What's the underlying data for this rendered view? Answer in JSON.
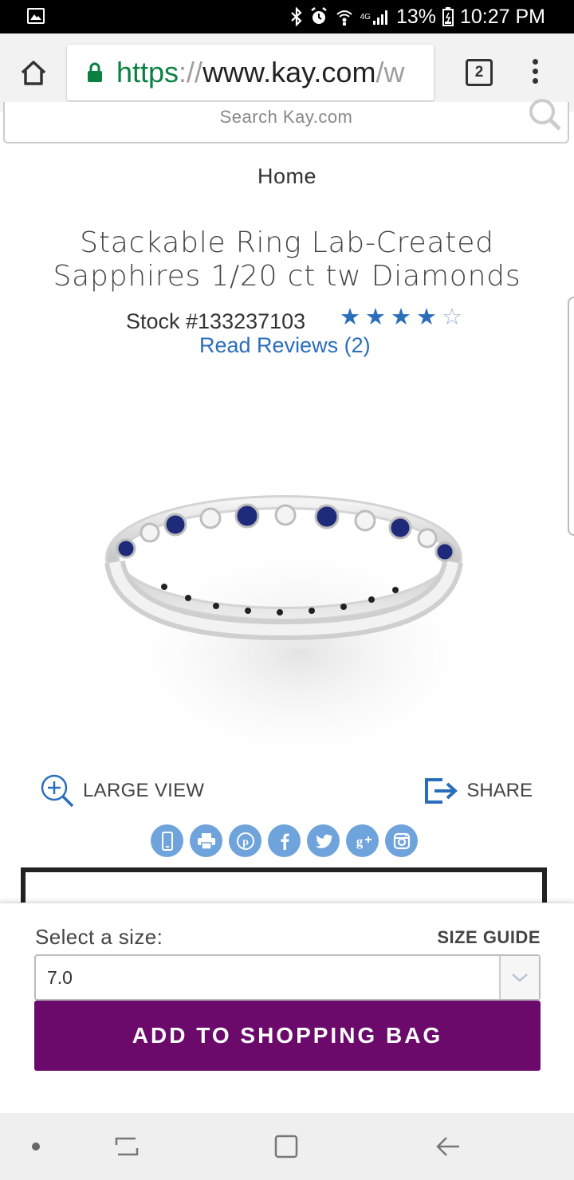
{
  "status_bar": {
    "network": "4G",
    "battery": "13%",
    "time": "10:27 PM"
  },
  "browser": {
    "url_scheme": "https",
    "url_sep": "://",
    "url_host": "www.kay.com",
    "url_rest": "/w",
    "tab_count": "2"
  },
  "search": {
    "placeholder": "Search Kay.com"
  },
  "breadcrumb": "Home",
  "product": {
    "title": "Stackable Ring Lab-Created Sapphires 1/20 ct tw Diamonds",
    "stock": "Stock #133237103",
    "rating": 4,
    "rating_max": 5,
    "reviews_label": "Read Reviews (2)"
  },
  "actions": {
    "large_view": "LARGE VIEW",
    "share": "SHARE"
  },
  "social_icons": [
    "mobile-icon",
    "print-icon",
    "pinterest-icon",
    "facebook-icon",
    "twitter-icon",
    "google-plus-icon",
    "instagram-icon"
  ],
  "purchase": {
    "size_label": "Select a size:",
    "size_guide": "SIZE GUIDE",
    "size_value": "7.0",
    "add_button": "ADD TO SHOPPING BAG"
  },
  "colors": {
    "accent_blue": "#2a6ebb",
    "cta_purple": "#6b0a6b",
    "url_green": "#0b8043"
  }
}
